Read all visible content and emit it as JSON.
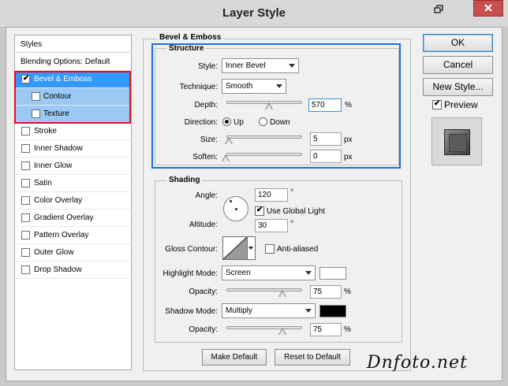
{
  "window": {
    "title": "Layer Style",
    "restore_icon": "restore-icon",
    "close_icon": "close-icon",
    "close_color": "#c74f4f"
  },
  "styles_panel": {
    "header": "Styles",
    "blending_options": "Blending Options: Default",
    "items": [
      {
        "label": "Bevel & Emboss",
        "checked": true,
        "selected": true
      },
      {
        "label": "Contour",
        "checked": false,
        "sub": true
      },
      {
        "label": "Texture",
        "checked": false,
        "sub": true
      },
      {
        "label": "Stroke",
        "checked": false
      },
      {
        "label": "Inner Shadow",
        "checked": false
      },
      {
        "label": "Inner Glow",
        "checked": false
      },
      {
        "label": "Satin",
        "checked": false
      },
      {
        "label": "Color Overlay",
        "checked": false
      },
      {
        "label": "Gradient Overlay",
        "checked": false
      },
      {
        "label": "Pattern Overlay",
        "checked": false
      },
      {
        "label": "Outer Glow",
        "checked": false
      },
      {
        "label": "Drop Shadow",
        "checked": false
      }
    ],
    "highlight_color": "#e0121c"
  },
  "bevel": {
    "group_title": "Bevel & Emboss",
    "structure": {
      "title": "Structure",
      "style_label": "Style:",
      "style_value": "Inner Bevel",
      "technique_label": "Technique:",
      "technique_value": "Smooth",
      "depth_label": "Depth:",
      "depth_value": "570",
      "depth_unit": "%",
      "direction_label": "Direction:",
      "direction_up": "Up",
      "direction_down": "Down",
      "direction_selected": "Up",
      "size_label": "Size:",
      "size_value": "5",
      "size_unit": "px",
      "soften_label": "Soften:",
      "soften_value": "0",
      "soften_unit": "px"
    },
    "shading": {
      "title": "Shading",
      "angle_label": "Angle:",
      "angle_value": "120",
      "angle_unit": "°",
      "use_global_light": "Use Global Light",
      "use_global_light_checked": true,
      "altitude_label": "Altitude:",
      "altitude_value": "30",
      "altitude_unit": "°",
      "gloss_contour_label": "Gloss Contour:",
      "anti_aliased": "Anti-aliased",
      "anti_aliased_checked": false,
      "highlight_mode_label": "Highlight Mode:",
      "highlight_mode_value": "Screen",
      "highlight_color": "#ffffff",
      "highlight_opacity_label": "Opacity:",
      "highlight_opacity_value": "75",
      "highlight_opacity_unit": "%",
      "shadow_mode_label": "Shadow Mode:",
      "shadow_mode_value": "Multiply",
      "shadow_color": "#000000",
      "shadow_opacity_label": "Opacity:",
      "shadow_opacity_value": "75",
      "shadow_opacity_unit": "%"
    },
    "make_default": "Make Default",
    "reset_to_default": "Reset to Default"
  },
  "actions": {
    "ok": "OK",
    "cancel": "Cancel",
    "new_style": "New Style...",
    "preview": "Preview",
    "preview_checked": true
  },
  "watermark": "Dnfoto.net"
}
